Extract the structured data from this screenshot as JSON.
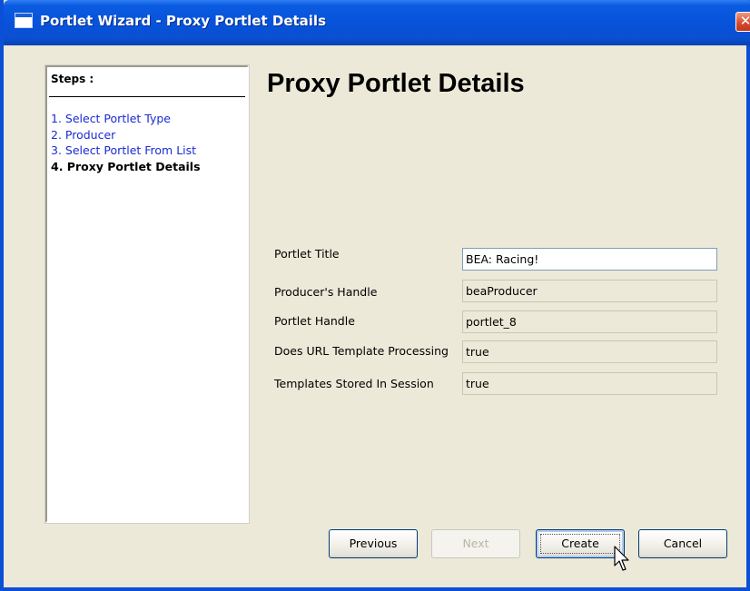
{
  "window": {
    "title": "Portlet Wizard - Proxy Portlet Details",
    "close_glyph": "✕",
    "accent_color": "#0753db"
  },
  "steps": {
    "header": "Steps :",
    "items": [
      {
        "label": "1. Select Portlet Type",
        "state": "link"
      },
      {
        "label": "2. Producer",
        "state": "link"
      },
      {
        "label": "3. Select Portlet From List",
        "state": "link"
      },
      {
        "label": "4. Proxy Portlet Details",
        "state": "current"
      }
    ]
  },
  "main": {
    "title": "Proxy Portlet Details",
    "fields": [
      {
        "label": "Portlet Title",
        "value": "BEA: Racing!",
        "editable": true
      },
      {
        "label": "Producer's Handle",
        "value": "beaProducer",
        "editable": false
      },
      {
        "label": "Portlet Handle",
        "value": "portlet_8",
        "editable": false
      },
      {
        "label": "Does URL Template Processing",
        "value": "true",
        "editable": false
      },
      {
        "label": "Templates Stored In Session",
        "value": "true",
        "editable": false
      }
    ]
  },
  "buttons": {
    "previous": "Previous",
    "next": "Next",
    "create": "Create",
    "cancel": "Cancel"
  },
  "icons": {
    "window_icon": "window-icon",
    "close": "close-icon",
    "cursor": "mouse-pointer-icon"
  }
}
